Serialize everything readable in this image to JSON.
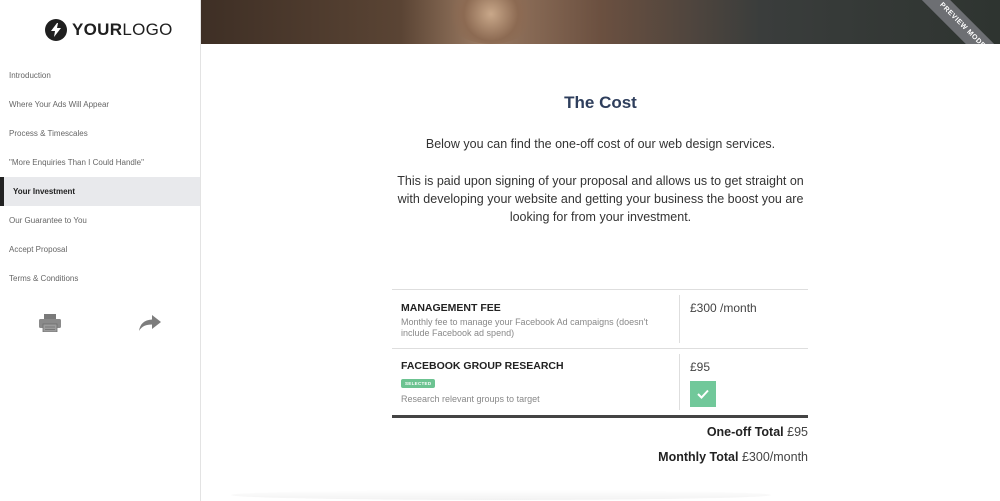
{
  "logo": {
    "bold": "YOUR",
    "light": "LOGO",
    "icon": "lightning-bolt-icon"
  },
  "sidebar": {
    "items": [
      {
        "label": "Introduction"
      },
      {
        "label": "Where Your Ads Will Appear"
      },
      {
        "label": "Process & Timescales"
      },
      {
        "label": "\"More Enquiries Than I Could Handle\""
      },
      {
        "label": "Your Investment"
      },
      {
        "label": "Our Guarantee to You"
      },
      {
        "label": "Accept Proposal"
      },
      {
        "label": "Terms & Conditions"
      }
    ],
    "active_index": 4,
    "actions": {
      "print_icon": "printer-icon",
      "share_icon": "share-arrow-icon"
    }
  },
  "ribbon": {
    "label": "PREVIEW MODE"
  },
  "main": {
    "title": "The Cost",
    "paragraph1": "Below you can find the one-off cost of our web design services.",
    "paragraph2": "This is paid upon signing of your proposal and allows us to get straight on with developing your website and getting your business the boost you are looking for from your investment."
  },
  "pricing": {
    "items": [
      {
        "name": "MANAGEMENT FEE",
        "description": "Monthly fee to manage your Facebook Ad campaigns (doesn't include Facebook ad spend)",
        "price": "£300 /month"
      },
      {
        "name": "FACEBOOK GROUP RESEARCH",
        "badge": "SELECTED",
        "description": "Research relevant groups to target",
        "price": "£95",
        "selected": true
      }
    ],
    "one_off_label": "One-off Total",
    "one_off_value": "£95",
    "monthly_label": "Monthly Total",
    "monthly_value": "£300/month"
  },
  "colors": {
    "accent_green": "#71c89a",
    "title_blue": "#2e3e5c",
    "active_bar": "#222222"
  }
}
